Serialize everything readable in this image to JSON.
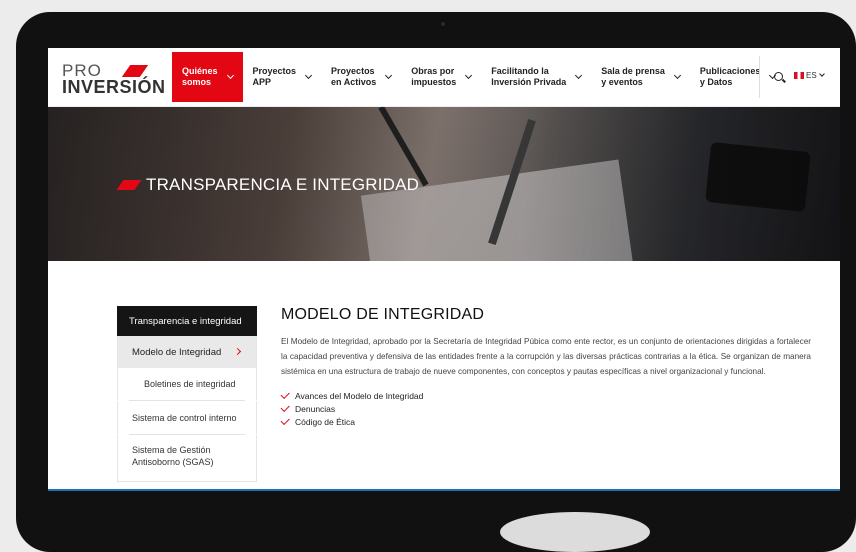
{
  "header": {
    "logo_top": "PRO",
    "logo_bottom": "INVERSIÓN",
    "nav": [
      {
        "label": "Quiénes\nsomos",
        "active": true
      },
      {
        "label": "Proyectos\nAPP",
        "active": false
      },
      {
        "label": "Proyectos\nen Activos",
        "active": false
      },
      {
        "label": "Obras por\nimpuestos",
        "active": false
      },
      {
        "label": "Facilitando la\nInversión Privada",
        "active": false
      },
      {
        "label": "Sala de prensa\ny eventos",
        "active": false
      },
      {
        "label": "Publicaciones\ny Datos",
        "active": false
      }
    ],
    "language": "ES"
  },
  "hero": {
    "title": "TRANSPARENCIA E INTEGRIDAD"
  },
  "sidebar": {
    "heading": "Transparencia e integridad",
    "items": [
      {
        "label": "Modelo de Integridad",
        "active": true
      },
      {
        "label": "Boletines de integridad",
        "sub": true
      },
      {
        "label": "Sistema de control interno"
      },
      {
        "label": "Sistema de Gestión Antisoborno (SGAS)"
      }
    ]
  },
  "content": {
    "title": "MODELO DE INTEGRIDAD",
    "body": "El Modelo de Integridad, aprobado por la Secretaría de Integridad Púbica como ente rector, es un conjunto de orientaciones dirigidas a fortalecer la capacidad preventiva y defensiva de las entidades frente a la corrupción y las diversas prácticas contrarias a la ética. Se organizan de manera sistémica en una estructura de trabajo de nueve componentes, con conceptos y pautas específicas a nivel organizacional y funcional.",
    "links": [
      "Avances del Modelo de Integridad",
      "Denuncias",
      "Código de Ética"
    ]
  },
  "colors": {
    "accent": "#e30613",
    "sidebar_head": "#151515"
  }
}
